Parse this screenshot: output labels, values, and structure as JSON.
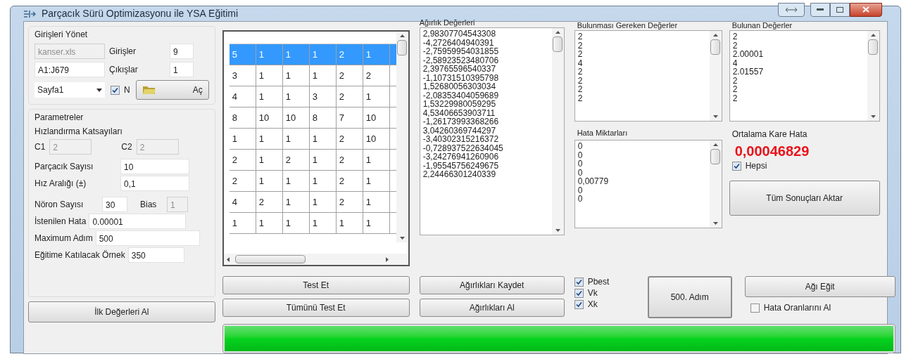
{
  "window": {
    "title": "Parçacık Sürü Optimizasyonu ile YSA Eğitimi"
  },
  "inputs_group": {
    "title": "Girişleri Yönet",
    "file": "kanser.xls",
    "range": "A1:J679",
    "sheet": "Sayfa1",
    "inputs_label": "Girişler",
    "inputs_value": "9",
    "outputs_label": "Çıkışlar",
    "outputs_value": "1",
    "normalize": {
      "label": "N",
      "checked": true
    },
    "open_button": "Aç"
  },
  "params_group": {
    "title": "Parametreler",
    "accel_label": "Hızlandırma Katsayıları",
    "c1_label": "C1",
    "c1_value": "2",
    "c2_label": "C2",
    "c2_value": "2",
    "particles_label": "Parçacık Sayısı",
    "particles_value": "10",
    "speed_label": "Hız Aralığı (±)",
    "speed_value": "0,1",
    "neurons_label": "Nöron Sayısı",
    "neurons_value": "30",
    "bias_label": "Bias",
    "bias_value": "1",
    "error_label": "İstenilen Hata",
    "error_value": "0.00001",
    "max_steps_label": "Maximum Adım",
    "max_steps_value": "500",
    "samples_label": "Eğitime Katılacak Örnek",
    "samples_value": "350"
  },
  "initial_button": "İlk Değerleri Al",
  "grid": {
    "rows": [
      {
        "selected": true,
        "cells": [
          "5",
          "1",
          "1",
          "1",
          "2",
          "1"
        ]
      },
      {
        "selected": false,
        "cells": [
          "3",
          "1",
          "1",
          "1",
          "2",
          "2"
        ]
      },
      {
        "selected": false,
        "cells": [
          "4",
          "1",
          "1",
          "3",
          "2",
          "1"
        ]
      },
      {
        "selected": false,
        "cells": [
          "8",
          "10",
          "10",
          "8",
          "7",
          "10"
        ]
      },
      {
        "selected": false,
        "cells": [
          "1",
          "1",
          "1",
          "1",
          "2",
          "10"
        ]
      },
      {
        "selected": false,
        "cells": [
          "2",
          "1",
          "2",
          "1",
          "2",
          "1"
        ]
      },
      {
        "selected": false,
        "cells": [
          "2",
          "1",
          "1",
          "1",
          "2",
          "1"
        ]
      },
      {
        "selected": false,
        "cells": [
          "4",
          "2",
          "1",
          "1",
          "2",
          "1"
        ]
      },
      {
        "selected": false,
        "cells": [
          "1",
          "1",
          "1",
          "1",
          "1",
          "1"
        ]
      }
    ]
  },
  "weights": {
    "title": "Ağırlık Değerleri",
    "values": [
      "2,98307704543308",
      "-4,2726404940391",
      "-2,75959954031855",
      "-2,58923523480706",
      "2,39765596540337",
      "-1,10731510395798",
      "1,52680056303034",
      "-2,08353404059689",
      "1,53229980059295",
      "4,53406653903711",
      "-1,26173993368266",
      "3,04260369744297",
      "-3,40302315216372",
      "-0,728937522634045",
      "-3,24276941260906",
      "-1,95545756249675",
      "2,24466301240339"
    ]
  },
  "expected": {
    "title": "Bulunması Gereken Değerler",
    "values": [
      "2",
      "2",
      "2",
      "4",
      "2",
      "2",
      "2",
      "2"
    ]
  },
  "found": {
    "title": "Bulunan Değerler",
    "values": [
      "2",
      "2",
      "2.00001",
      "4",
      "2.01557",
      "2",
      "2",
      "2"
    ]
  },
  "errors": {
    "title": "Hata Miktarları",
    "values": [
      "0",
      "0",
      "0",
      "0",
      "0,00779",
      "0",
      "0"
    ]
  },
  "mse": {
    "title": "Ortalama Kare Hata",
    "value": "0,00046829",
    "all": {
      "label": "Hepsi",
      "checked": true
    },
    "export_button": "Tüm Sonuçları Aktar"
  },
  "buttons": {
    "test": "Test Et",
    "test_all": "Tümünü Test Et",
    "save_weights": "Ağırlıkları Kaydet",
    "load_weights": "Ağırlıkları Al",
    "step": "500. Adım",
    "train": "Ağı Eğit"
  },
  "options": [
    {
      "label": "Pbest",
      "checked": true
    },
    {
      "label": "Vk",
      "checked": true
    },
    {
      "label": "Xk",
      "checked": true
    }
  ],
  "error_rates": {
    "label": "Hata Oranlarını Al",
    "checked": false
  },
  "progress": {
    "level": 1
  }
}
